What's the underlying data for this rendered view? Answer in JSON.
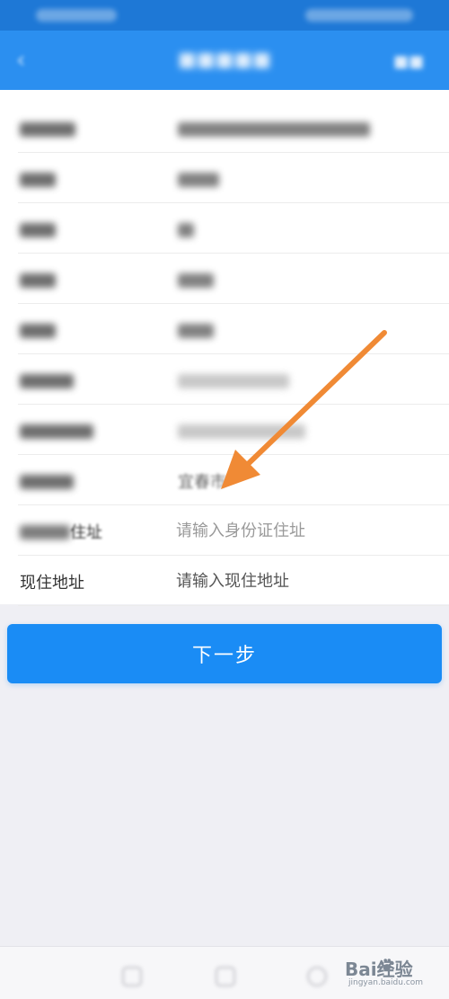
{
  "form": {
    "rows": [
      {
        "label": "",
        "value": ""
      },
      {
        "label": "",
        "value": ""
      },
      {
        "label": "",
        "value": ""
      },
      {
        "label": "",
        "value": ""
      },
      {
        "label": "",
        "value": ""
      },
      {
        "label": "",
        "value": ""
      },
      {
        "label": "",
        "value": ""
      },
      {
        "label": "",
        "value": "宜春市"
      },
      {
        "label": "住址",
        "placeholder": "请输入身份证住址"
      },
      {
        "label": "现住地址",
        "placeholder": "请输入现住地址"
      }
    ]
  },
  "actions": {
    "next_label": "下一步"
  },
  "watermark": {
    "brand": "Bai经验",
    "url": "jingyan.baidu.com"
  },
  "colors": {
    "nav_bar": "#2b8ff0",
    "button": "#1a8cf5",
    "annotation_arrow": "#f08a35"
  },
  "icons": {
    "nav_back": "chevron-left-icon",
    "annotation": "orange-arrow-icon",
    "watermark": "paw-icon"
  }
}
